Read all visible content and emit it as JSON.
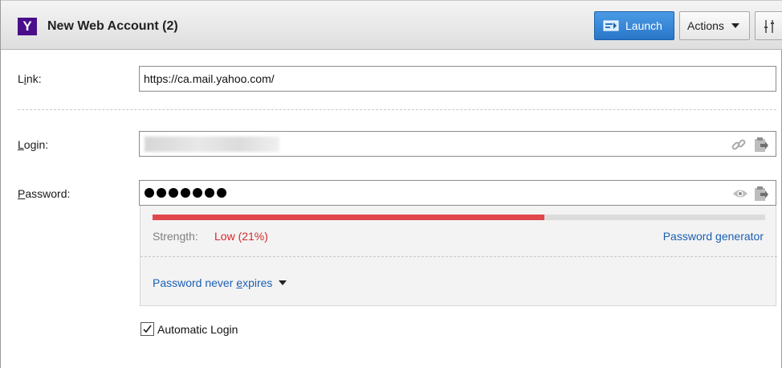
{
  "header": {
    "logo_letter": "Y",
    "title": "New Web Account (2)",
    "launch_label": "Launch",
    "actions_label": "Actions"
  },
  "form": {
    "link": {
      "label_prefix": "L",
      "label_underlined": "i",
      "label_suffix": "nk:",
      "value": "https://ca.mail.yahoo.com/"
    },
    "login": {
      "label_underlined": "L",
      "label_suffix": "ogin:"
    },
    "password": {
      "label_underlined": "P",
      "label_suffix": "assword:",
      "masked_length": 7
    },
    "strength": {
      "label": "Strength:",
      "value": "Low (21%)",
      "percent": 0.64,
      "color": "#e0474a"
    },
    "password_generator_label": "Password generator",
    "expires": {
      "prefix": "Password never ",
      "underlined": "e",
      "suffix": "xpires"
    },
    "automatic_login": {
      "label": "Automatic Login",
      "checked": true
    }
  },
  "colors": {
    "accent": "#2a76c9",
    "link": "#1a5fb4",
    "danger": "#d9272b"
  },
  "icons": {
    "logo": "yahoo-logo",
    "launch": "launch-icon",
    "actions_caret": "chevron-down-icon",
    "settings": "settings-sliders-icon",
    "link": "link-icon",
    "copy": "clipboard-copy-icon",
    "reveal": "eye-icon"
  }
}
